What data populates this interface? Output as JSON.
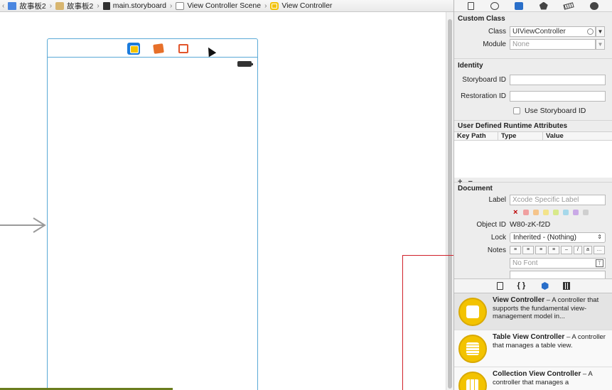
{
  "jumpbar": {
    "crumbs": [
      {
        "label": "故事板2",
        "icon": "project-icon"
      },
      {
        "label": "故事板2",
        "icon": "folder-icon"
      },
      {
        "label": "main.storyboard",
        "icon": "storyboard-file-icon"
      },
      {
        "label": "View Controller Scene",
        "icon": "scene-icon"
      },
      {
        "label": "View Controller",
        "icon": "view-controller-icon"
      }
    ]
  },
  "inspector": {
    "custom_class": {
      "title": "Custom Class",
      "class_label": "Class",
      "class_value": "UIViewController",
      "module_label": "Module",
      "module_value": "None"
    },
    "identity": {
      "title": "Identity",
      "storyboard_id_label": "Storyboard ID",
      "storyboard_id_value": "",
      "restoration_id_label": "Restoration ID",
      "restoration_id_value": "",
      "use_storyboard_id_label": "Use Storyboard ID"
    },
    "udra": {
      "title": "User Defined Runtime Attributes",
      "columns": [
        "Key Path",
        "Type",
        "Value"
      ],
      "add": "+",
      "remove": "−"
    },
    "document": {
      "title": "Document",
      "label_label": "Label",
      "label_placeholder": "Xcode Specific Label",
      "swatch_colors": [
        "#f0a0a0",
        "#f5c48a",
        "#f3e38a",
        "#d8e98a",
        "#a6d8ea",
        "#c9a9e6",
        "#cfcfcf"
      ],
      "object_id_label": "Object ID",
      "object_id_value": "W80-zK-f2D",
      "lock_label": "Lock",
      "lock_value": "Inherited - (Nothing)",
      "notes_label": "Notes",
      "font_placeholder": "No Font"
    }
  },
  "library": {
    "items": [
      {
        "title": "View Controller",
        "desc": " – A controller that supports the fundamental view-management model in..."
      },
      {
        "title": "Table View Controller",
        "desc": " – A controller that manages a table view."
      },
      {
        "title": "Collection View Controller",
        "desc": " – A controller that manages a"
      }
    ]
  },
  "colors": {
    "scene_border": "#5aa9d6",
    "accent_blue": "#1b7bdc",
    "vc_yellow": "#f3c300",
    "annotation_red": "#d0202a"
  }
}
